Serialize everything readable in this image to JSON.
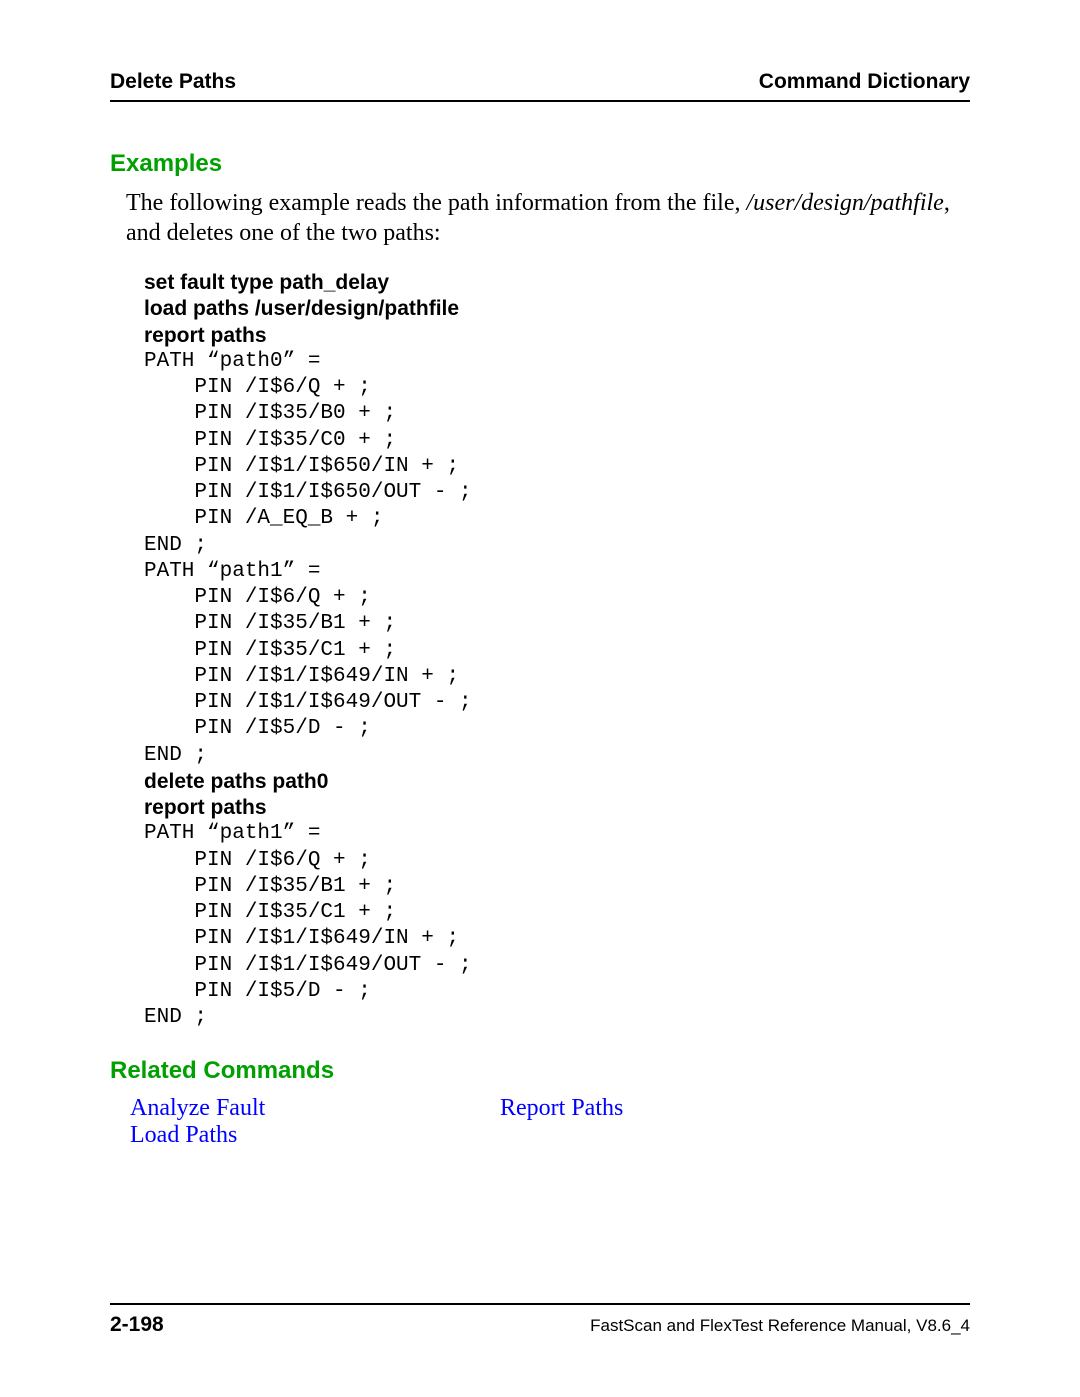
{
  "header": {
    "left": "Delete Paths",
    "right": "Command Dictionary"
  },
  "examples": {
    "heading": "Examples",
    "intro_plain1": "The following example reads the path information from the file, ",
    "intro_italic": "/user/design/pathfile",
    "intro_plain2": ", and deletes one of the two paths:",
    "lines": [
      {
        "style": "bold",
        "text": "set fault type path_delay"
      },
      {
        "style": "bold",
        "text": "load paths /user/design/pathfile"
      },
      {
        "style": "bold",
        "text": "report paths"
      },
      {
        "style": "mono",
        "text": "PATH “path0” ="
      },
      {
        "style": "mono",
        "text": "    PIN /I$6/Q + ;"
      },
      {
        "style": "mono",
        "text": "    PIN /I$35/B0 + ;"
      },
      {
        "style": "mono",
        "text": "    PIN /I$35/C0 + ;"
      },
      {
        "style": "mono",
        "text": "    PIN /I$1/I$650/IN + ;"
      },
      {
        "style": "mono",
        "text": "    PIN /I$1/I$650/OUT - ;"
      },
      {
        "style": "mono",
        "text": "    PIN /A_EQ_B + ;"
      },
      {
        "style": "mono",
        "text": "END ;"
      },
      {
        "style": "mono",
        "text": "PATH “path1” ="
      },
      {
        "style": "mono",
        "text": "    PIN /I$6/Q + ;"
      },
      {
        "style": "mono",
        "text": "    PIN /I$35/B1 + ;"
      },
      {
        "style": "mono",
        "text": "    PIN /I$35/C1 + ;"
      },
      {
        "style": "mono",
        "text": "    PIN /I$1/I$649/IN + ;"
      },
      {
        "style": "mono",
        "text": "    PIN /I$1/I$649/OUT - ;"
      },
      {
        "style": "mono",
        "text": "    PIN /I$5/D - ;"
      },
      {
        "style": "mono",
        "text": "END ;"
      },
      {
        "style": "bold",
        "text": "delete paths path0"
      },
      {
        "style": "bold",
        "text": "report paths"
      },
      {
        "style": "mono",
        "text": "PATH “path1” ="
      },
      {
        "style": "mono",
        "text": "    PIN /I$6/Q + ;"
      },
      {
        "style": "mono",
        "text": "    PIN /I$35/B1 + ;"
      },
      {
        "style": "mono",
        "text": "    PIN /I$35/C1 + ;"
      },
      {
        "style": "mono",
        "text": "    PIN /I$1/I$649/IN + ;"
      },
      {
        "style": "mono",
        "text": "    PIN /I$1/I$649/OUT - ;"
      },
      {
        "style": "mono",
        "text": "    PIN /I$5/D - ;"
      },
      {
        "style": "mono",
        "text": "END ;"
      }
    ]
  },
  "related": {
    "heading": "Related Commands",
    "left": [
      "Analyze Fault",
      "Load Paths"
    ],
    "right": [
      "Report Paths"
    ]
  },
  "footer": {
    "page": "2-198",
    "doc": "FastScan and FlexTest Reference Manual, V8.6_4"
  }
}
